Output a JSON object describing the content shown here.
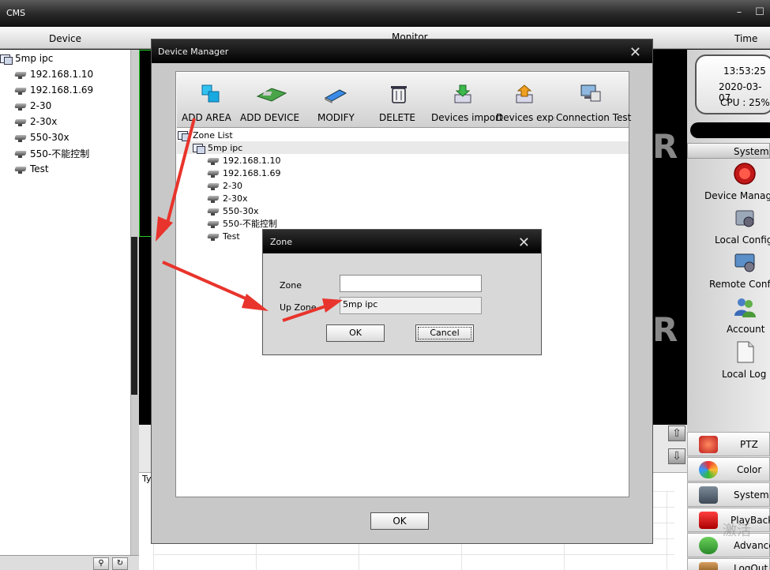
{
  "app": {
    "title": "CMS"
  },
  "header": {
    "device": "Device",
    "monitor": "Monitor",
    "time": "Time"
  },
  "left_tree": {
    "root": "5mp ipc",
    "children": [
      "192.168.1.10",
      "192.168.1.69",
      "2-30",
      "2-30x",
      "550-30x",
      "550-不能控制",
      "Test"
    ]
  },
  "clock": {
    "time": "13:53:25",
    "date": "2020-03-07",
    "cpu": "CPU : 25%"
  },
  "right_panel": {
    "system_header": "System",
    "items": [
      "Device Manage",
      "Local Config",
      "Remote Config",
      "Account",
      "Local Log"
    ],
    "lower": [
      "PTZ",
      "Color",
      "System",
      "PlayBack",
      "Advance",
      "LogOut"
    ]
  },
  "device_manager": {
    "title": "Device Manager",
    "toolbar": [
      "ADD AREA",
      "ADD DEVICE",
      "MODIFY",
      "DELETE",
      "Devices import",
      "Devices export",
      "Connection Test"
    ],
    "zone_list_label": "Zone List",
    "zone_root": "5mp ipc",
    "zone_children": [
      "192.168.1.10",
      "192.168.1.69",
      "2-30",
      "2-30x",
      "550-30x",
      "550-不能控制",
      "Test"
    ],
    "ok": "OK"
  },
  "zone_dialog": {
    "title": "Zone",
    "zone_label": "Zone",
    "zone_value": "",
    "upzone_label": "Up Zone",
    "upzone_value": "5mp ipc",
    "ok": "OK",
    "cancel": "Cancel"
  },
  "center": {
    "tab_partial": "Ty"
  },
  "watermark": "激活",
  "colors": {
    "arrow": "#e8342c",
    "titlebar": "#111111",
    "green_frame": "#22cc22"
  }
}
